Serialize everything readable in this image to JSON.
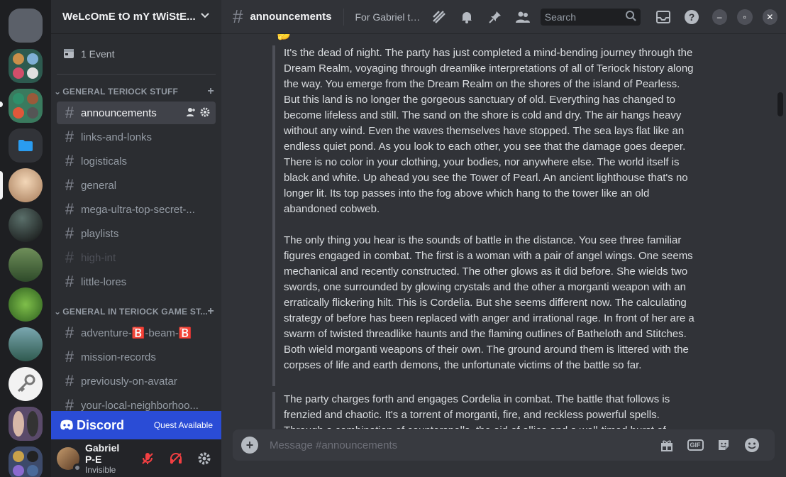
{
  "guild": {
    "name": "WeLcOmE tO mY tWiStE..."
  },
  "events": {
    "label": "1 Event"
  },
  "categories": [
    {
      "name": "GENERAL TERIOCK STUFF"
    },
    {
      "name": "GENERAL IN TERIOCK GAME ST..."
    }
  ],
  "channels_a": [
    {
      "name": "announcements"
    },
    {
      "name": "links-and-lonks"
    },
    {
      "name": "logisticals"
    },
    {
      "name": "general"
    },
    {
      "name": "mega-ultra-top-secret-..."
    },
    {
      "name": "playlists"
    },
    {
      "name": "high-int"
    },
    {
      "name": "little-lores"
    }
  ],
  "channels_b": [
    {
      "name": "adventure-🅱️-beam-🅱️"
    },
    {
      "name": "mission-records"
    },
    {
      "name": "previously-on-avatar"
    },
    {
      "name": "your-local-neighborhoo..."
    }
  ],
  "quest": {
    "brand": "Discord",
    "text": "Quest Available"
  },
  "user": {
    "name": "Gabriel P-E",
    "status": "Invisible"
  },
  "header": {
    "channel": "announcements",
    "topic": "For Gabriel to ...",
    "search_placeholder": "Search"
  },
  "messages": [
    "It's the dead of night. The party has just completed a mind-bending journey through the Dream Realm, voyaging through dreamlike interpretations of all of Teriock history along the way. You emerge from the Dream Realm on the shores of the island of Pearless. But this land is no longer the gorgeous sanctuary of old. Everything has changed to become lifeless and still. The sand on the shore is cold and dry. The air hangs heavy without any wind. Even the waves themselves have stopped. The sea lays flat like an endless quiet pond. As you look to each other, you see that the damage goes deeper. There is no color in your clothing, your bodies, nor anywhere else. The world itself is black and white. Up ahead you see the Tower of Pearl. An ancient lighthouse that's no longer lit. Its top passes into the fog above which hang to the tower like an old abandoned cobweb.",
    "The only thing you hear is the sounds of battle in the distance. You see three familiar figures engaged in combat. The first is a woman with a pair of angel wings. One seems mechanical and recently constructed. The other glows as it did before. She wields two swords, one surrounded by glowing crystals and the other a morganti weapon with an erratically flickering hilt. This is Cordelia. But she seems different now. The calculating strategy of before has been replaced with anger and irrational rage. In front of her are a swarm of twisted threadlike haunts and the flaming outlines of Batheloth and Stitches. Both wield morganti weapons of their own. The ground around them is littered with the corpses of life and earth demons, the unfortunate victims of the battle so far.",
    "The party charges forth and engages Cordelia in combat. The battle that follows is frenzied and chaotic. It's a torrent of morganti, fire, and reckless powerful spells. Through a combination of counterspells, the aid of allies and a well-timed burst of"
  ],
  "composer": {
    "placeholder": "Message #announcements"
  },
  "icons": {
    "calendar": "calendar-icon",
    "chevron": "chevron-down-icon",
    "plus": "plus-icon",
    "threads": "threads-icon",
    "bell": "bell-icon",
    "pin": "pin-icon",
    "members": "members-icon",
    "inbox": "inbox-icon",
    "help": "help-icon",
    "gift": "gift-icon",
    "sticker": "sticker-icon",
    "emoji": "emoji-icon"
  },
  "colors": {
    "brand": "#5865f2",
    "quest_bg": "#2a4cd6",
    "active_channel": "#404249",
    "mute_red": "#f23f42"
  }
}
